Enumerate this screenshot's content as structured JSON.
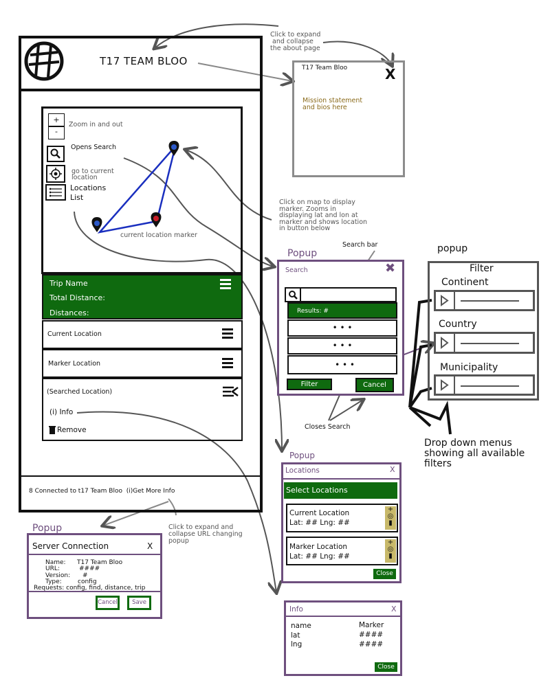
{
  "header": {
    "title": "T17 TEAM BLOO",
    "note_expand_about": "Click to expand\n and collapse\nthe about page"
  },
  "about_popup": {
    "title": "T17 Team Bloo",
    "close": "X",
    "body": "Mission statement\nand bios here"
  },
  "map_controls": {
    "zoom_in": "+",
    "zoom_out": "-",
    "zoom_note": "Zoom in and out",
    "search_note": "Opens Search",
    "current_location_note": "go to current\nlocation",
    "locations_list_label": "Locations\nList",
    "current_marker_note": "current location marker"
  },
  "map_note": "Click on map to display\nmarker. Zooms in\ndisplaying lat and lon at\nmarker and shows location\nin button below",
  "trip_panel": {
    "trip_name": "Trip Name",
    "total_distance": "Total Distance:",
    "distances": "Distances:",
    "current_location": "Current Location",
    "marker_location": "Marker Location",
    "searched_location": "(Searched Location)",
    "info": "(i) Info",
    "remove": "Remove"
  },
  "footer": {
    "status": "8 Connected to t17 Team Bloo  (i)Get More Info",
    "note": "Click to expand and\ncollapse URL changing\npopup"
  },
  "search_popup": {
    "popup_label": "Popup",
    "placeholder": "Search",
    "close": "✖",
    "bar_note": "Search bar",
    "results": "Results: #",
    "result_rows": [
      "• • •",
      "• • •",
      "• • •"
    ],
    "filter": "Filter",
    "cancel": "Cancel",
    "closes_note": "Closes Search"
  },
  "filter_popup": {
    "popup_label": "popup",
    "title": "Filter",
    "groups": [
      "Continent",
      "Country",
      "Municipality"
    ],
    "dropdown_note": "Drop down menus\nshowing all available\nfilters"
  },
  "locations_popup": {
    "popup_label": "Popup",
    "title": "Locations",
    "close": "X",
    "header": "Select Locations",
    "items": [
      {
        "name": "Current Location",
        "coords": "Lat: ## Lng: ##"
      },
      {
        "name": "Marker Location",
        "coords": "Lat: ## Lng: ##"
      }
    ],
    "close_button": "Close"
  },
  "server_popup": {
    "popup_label": "Popup",
    "title": "Server Connection",
    "close": "X",
    "fields": [
      {
        "key": "Name:",
        "value": "T17 Team Bloo"
      },
      {
        "key": "URL:",
        "value": "####"
      },
      {
        "key": "Version:",
        "value": "#"
      },
      {
        "key": "Type:",
        "value": "config"
      }
    ],
    "requests": "Requests: config, find, distance, trip",
    "cancel": "Cancel",
    "save": "Save"
  },
  "info_popup": {
    "title": "Info",
    "close": "X",
    "rows": [
      {
        "key": "name",
        "value": "Marker"
      },
      {
        "key": "lat",
        "value": "####"
      },
      {
        "key": "lng",
        "value": "####"
      }
    ],
    "close_button": "Close"
  },
  "colors": {
    "green": "#0f6a0f",
    "purple": "#6e4f7e",
    "note_brown": "#8a6a1a",
    "line_blue": "#1a2fbf"
  }
}
